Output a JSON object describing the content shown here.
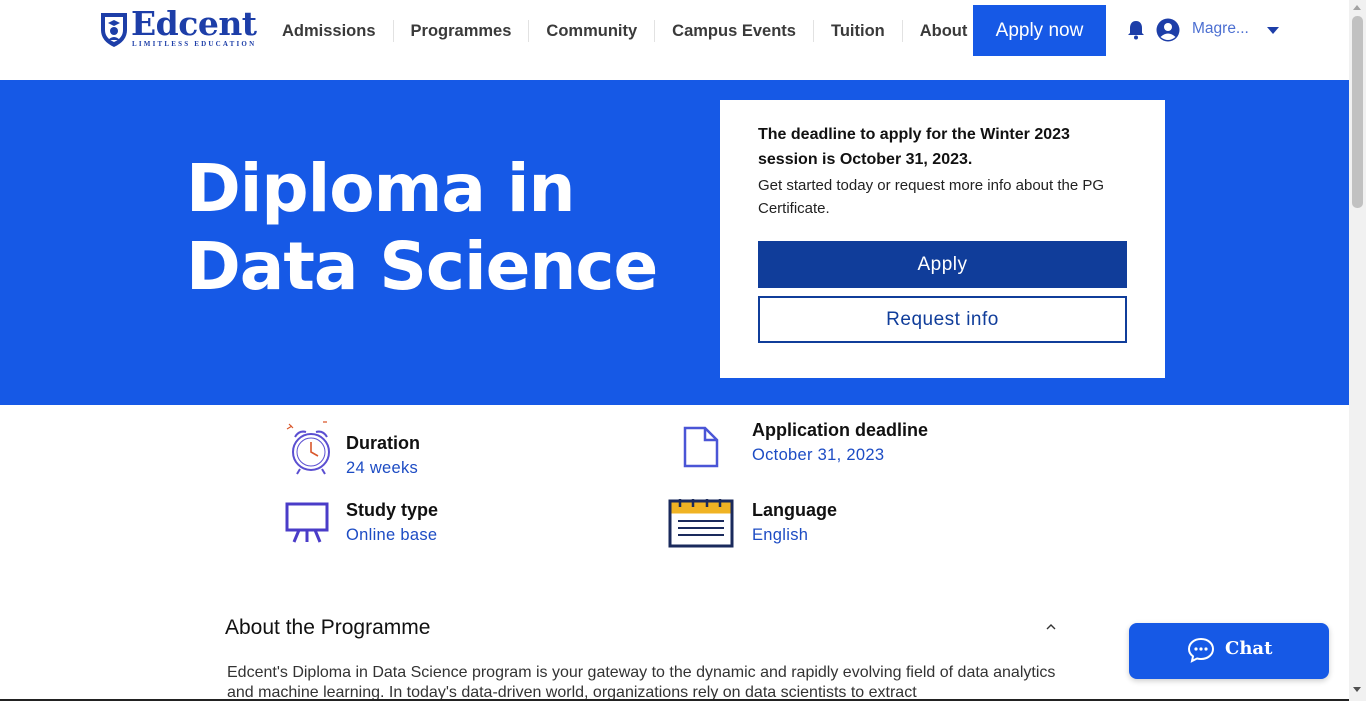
{
  "brand": {
    "name": "Edcent",
    "tagline": "LIMITLESS EDUCATION",
    "accent_color": "#1659e6",
    "dark_blue": "#103d9a"
  },
  "header": {
    "nav": [
      "Admissions",
      "Programmes",
      "Community",
      "Campus Events",
      "Tuition",
      "About"
    ],
    "apply_now": "Apply now",
    "notification_icon": "bell-icon",
    "avatar_icon": "user-circle-icon",
    "user_name": "Magre..."
  },
  "hero": {
    "title": "Diploma in Data Science",
    "deadline_notice": "The deadline to apply for the Winter 2023 session is October 31, 2023.",
    "info_text": "Get started today or request more info about the PG Certificate.",
    "apply_button": "Apply",
    "request_info_button": "Request info"
  },
  "facts": {
    "duration": {
      "label": "Duration",
      "value": "24 weeks",
      "icon": "alarm-clock-icon"
    },
    "deadline": {
      "label": "Application deadline",
      "value": "October 31, 2023",
      "icon": "document-icon"
    },
    "study_type": {
      "label": "Study type",
      "value": "Online base",
      "icon": "presentation-board-icon"
    },
    "language": {
      "label": "Language",
      "value": "English",
      "icon": "calendar-icon"
    }
  },
  "about": {
    "title": "About the Programme",
    "text": "Edcent's Diploma in Data Science program is your gateway to the dynamic and rapidly evolving field of data analytics and machine learning. In today's data-driven world, organizations rely on data scientists to extract"
  },
  "chat": {
    "label": "Chat",
    "icon": "chat-bubble-icon"
  }
}
